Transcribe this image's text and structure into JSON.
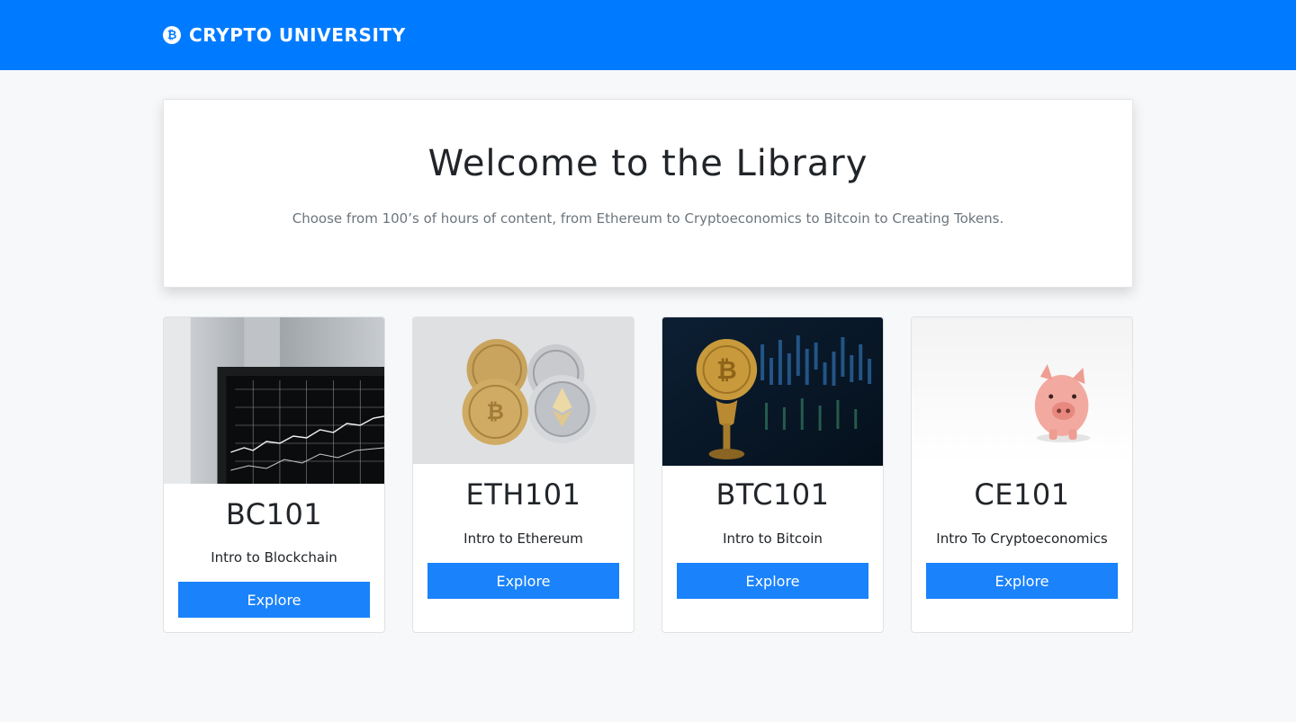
{
  "navbar": {
    "brand_icon": "bitcoin-icon",
    "brand_text": "CRYPTO UNIVERSITY",
    "color": "#007bff"
  },
  "hero": {
    "title": "Welcome to the Library",
    "subtitle": "Choose from 100’s of hours of content, from Ethereum to Cryptoeconomics to Bitcoin to Creating Tokens."
  },
  "courses": [
    {
      "code": "BC101",
      "name": "Intro to Blockchain",
      "button": "Explore",
      "image": "laptop-chart-photo"
    },
    {
      "code": "ETH101",
      "name": "Intro to Ethereum",
      "button": "Explore",
      "image": "crypto-coins-photo"
    },
    {
      "code": "BTC101",
      "name": "Intro to Bitcoin",
      "button": "Explore",
      "image": "bitcoin-coin-photo"
    },
    {
      "code": "CE101",
      "name": "Intro To Cryptoeconomics",
      "button": "Explore",
      "image": "piggy-bank-photo"
    }
  ],
  "colors": {
    "accent": "#1a82fb",
    "background": "#f7f8fa"
  }
}
